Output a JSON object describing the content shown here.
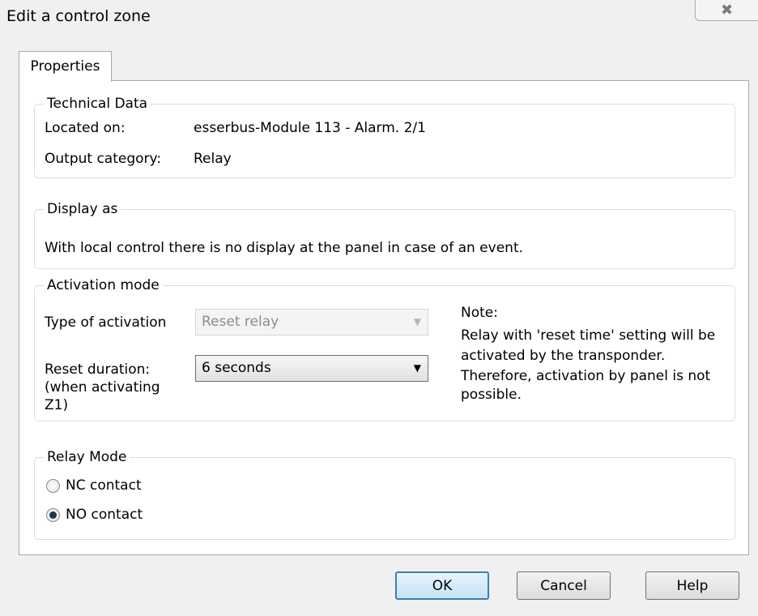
{
  "window": {
    "title": "Edit a control zone",
    "close_glyph": "✖"
  },
  "tabs": [
    {
      "label": "Properties",
      "active": true
    }
  ],
  "technical_data": {
    "legend": "Technical Data",
    "located_on_label": "Located on:",
    "located_on_value": "esserbus-Module 113 - Alarm. 2/1",
    "output_category_label": "Output category:",
    "output_category_value": "Relay"
  },
  "display_as": {
    "legend": "Display as",
    "text": "With local control there is no display at the panel in case of an event."
  },
  "activation_mode": {
    "legend": "Activation mode",
    "type_label": "Type of activation",
    "type_value": "Reset relay",
    "reset_label_1": "Reset duration:",
    "reset_label_2": "(when activating",
    "reset_label_3": "Z1)",
    "reset_value": "6 seconds",
    "note_title": "Note:",
    "note_1": "Relay with 'reset time' setting will be",
    "note_2": "activated by the transponder.",
    "note_3": "Therefore, activation by panel is not",
    "note_4": "possible."
  },
  "relay_mode": {
    "legend": "Relay Mode",
    "nc_label": "NC contact",
    "no_label": "NO contact",
    "selected": "NO contact"
  },
  "buttons": {
    "ok": "OK",
    "cancel": "Cancel",
    "help": "Help"
  },
  "icons": {
    "dropdown": "▼"
  }
}
